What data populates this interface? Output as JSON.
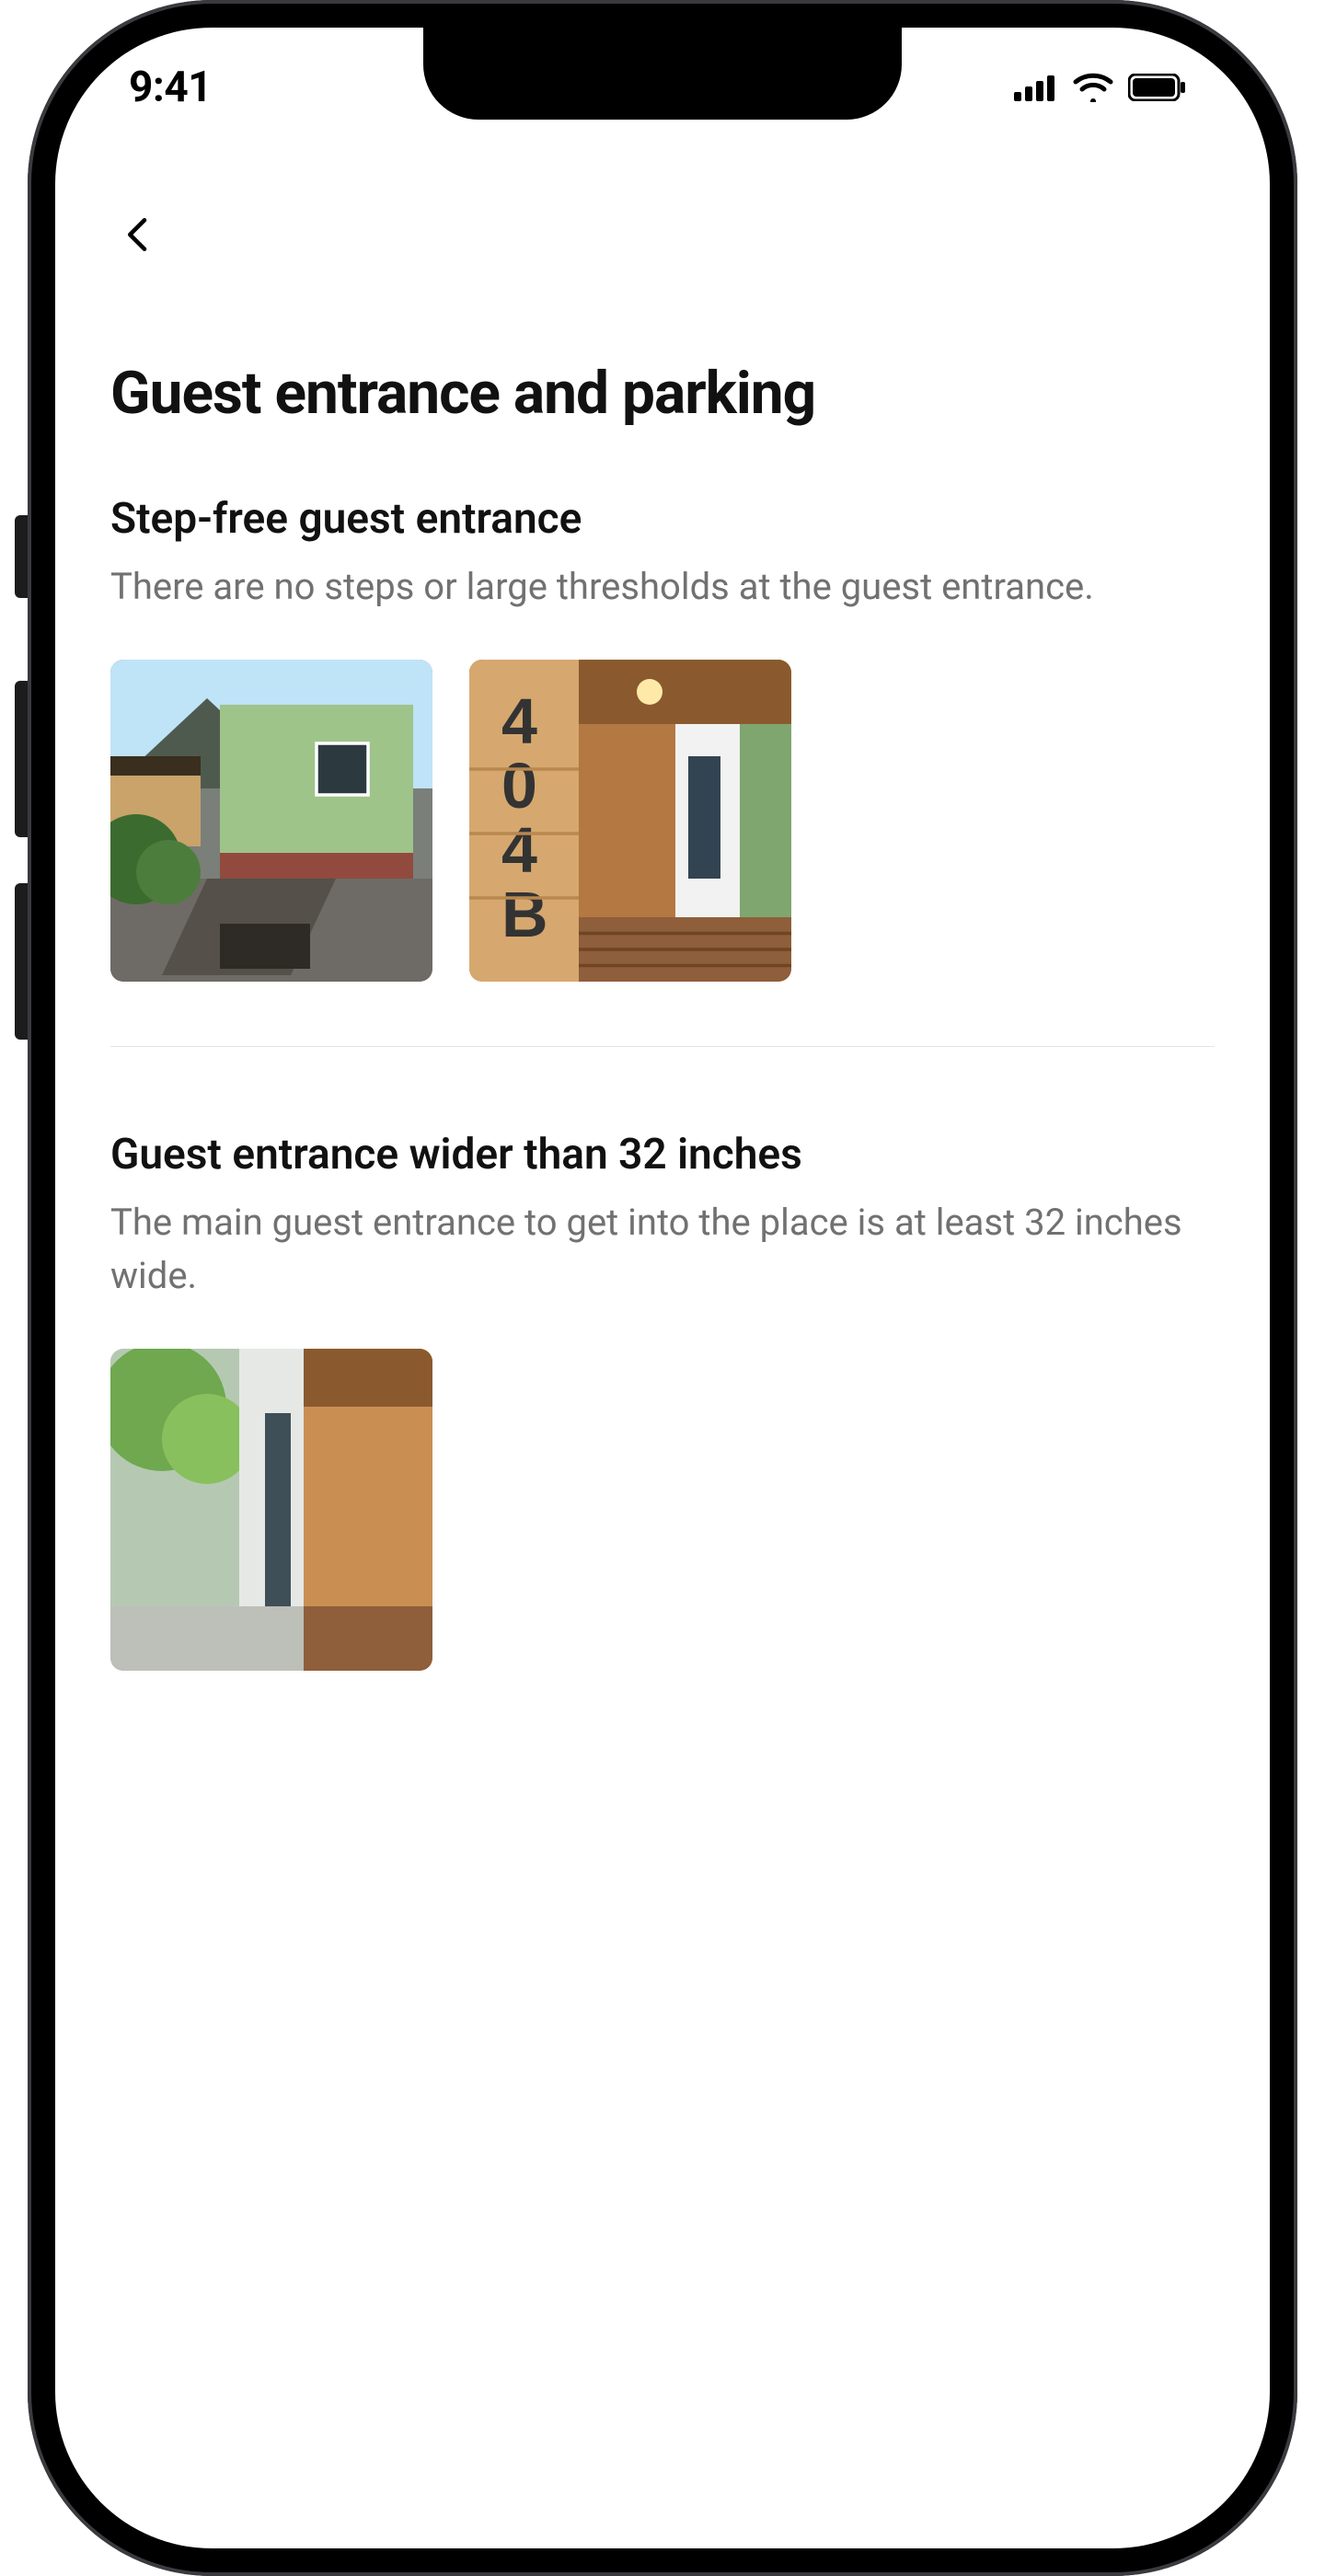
{
  "status": {
    "time": "9:41"
  },
  "page": {
    "title": "Guest entrance and parking"
  },
  "features": [
    {
      "heading": "Step-free guest entrance",
      "description": "There are no steps or large thresholds at the guest entrance.",
      "thumbs": 2
    },
    {
      "heading": "Guest entrance wider than 32 inches",
      "description": "The main guest entrance to get into the place is at least 32 inches wide.",
      "thumbs": 1
    }
  ]
}
